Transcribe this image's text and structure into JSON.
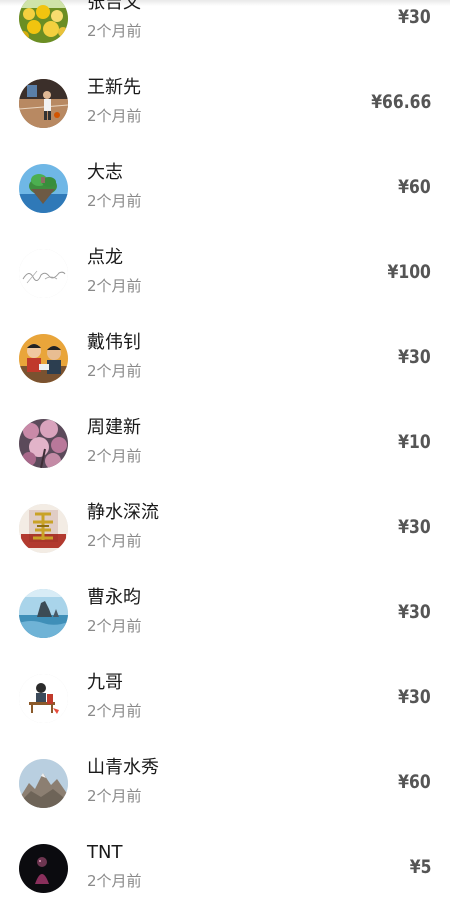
{
  "donations": [
    {
      "name": "张吉文",
      "time": "2个月前",
      "amount": "¥30",
      "avatar": "yellow-flowers-avatar"
    },
    {
      "name": "王新先",
      "time": "2个月前",
      "amount": "¥66.66",
      "avatar": "basketball-court-avatar"
    },
    {
      "name": "大志",
      "time": "2个月前",
      "amount": "¥60",
      "avatar": "floating-island-avatar"
    },
    {
      "name": "点龙",
      "time": "2个月前",
      "amount": "¥100",
      "avatar": "signature-avatar"
    },
    {
      "name": "戴伟钊",
      "time": "2个月前",
      "amount": "¥30",
      "avatar": "two-kids-avatar"
    },
    {
      "name": "周建新",
      "time": "2个月前",
      "amount": "¥10",
      "avatar": "pink-blossom-avatar"
    },
    {
      "name": "静水深流",
      "time": "2个月前",
      "amount": "¥30",
      "avatar": "fu-character-avatar"
    },
    {
      "name": "曹永昀",
      "time": "2个月前",
      "amount": "¥30",
      "avatar": "sea-rocks-avatar"
    },
    {
      "name": "九哥",
      "time": "2个月前",
      "amount": "¥30",
      "avatar": "bench-figure-avatar"
    },
    {
      "name": "山青水秀",
      "time": "2个月前",
      "amount": "¥60",
      "avatar": "mountain-avatar"
    },
    {
      "name": "TNT",
      "time": "2个月前",
      "amount": "¥5",
      "avatar": "dark-portrait-avatar"
    }
  ],
  "colors": {
    "name": "#1a1a1a",
    "time": "#8a8a8a",
    "amount": "#555555"
  }
}
